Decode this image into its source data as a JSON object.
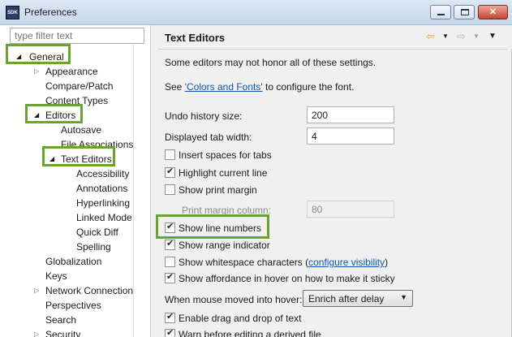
{
  "window": {
    "title": "Preferences",
    "icon_text": "SDK"
  },
  "filter": {
    "placeholder": "type filter text"
  },
  "tree": [
    {
      "label": "General",
      "level": 0,
      "expanded": true
    },
    {
      "label": "Appearance",
      "level": 1,
      "expanded": false
    },
    {
      "label": "Compare/Patch",
      "level": 1
    },
    {
      "label": "Content Types",
      "level": 1
    },
    {
      "label": "Editors",
      "level": 1,
      "expanded": true
    },
    {
      "label": "Autosave",
      "level": 2
    },
    {
      "label": "File Associations",
      "level": 2
    },
    {
      "label": "Text Editors",
      "level": 2,
      "expanded": true,
      "selected": true
    },
    {
      "label": "Accessibility",
      "level": 3
    },
    {
      "label": "Annotations",
      "level": 3
    },
    {
      "label": "Hyperlinking",
      "level": 3
    },
    {
      "label": "Linked Mode",
      "level": 3
    },
    {
      "label": "Quick Diff",
      "level": 3
    },
    {
      "label": "Spelling",
      "level": 3
    },
    {
      "label": "Globalization",
      "level": 1
    },
    {
      "label": "Keys",
      "level": 1
    },
    {
      "label": "Network Connections",
      "level": 1,
      "expanded": false
    },
    {
      "label": "Perspectives",
      "level": 1
    },
    {
      "label": "Search",
      "level": 1
    },
    {
      "label": "Security",
      "level": 1,
      "expanded": false
    }
  ],
  "page": {
    "title": "Text Editors",
    "note": "Some editors may not honor all of these settings.",
    "see_prefix": "See ",
    "colors_link": "'Colors and Fonts'",
    "see_suffix": " to configure the font.",
    "undo_label": "Undo history size:",
    "undo_value": "200",
    "tab_label": "Displayed tab width:",
    "tab_value": "4",
    "checkboxes": [
      {
        "label": "Insert spaces for tabs",
        "checked": false
      },
      {
        "label": "Highlight current line",
        "checked": true
      },
      {
        "label": "Show print margin",
        "checked": false
      },
      {
        "label": "Show line numbers",
        "checked": true
      },
      {
        "label": "Show range indicator",
        "checked": true
      },
      {
        "label": "Show whitespace characters",
        "checked": false
      },
      {
        "label": "Show affordance in hover on how to make it sticky",
        "checked": true
      },
      {
        "label": "Enable drag and drop of text",
        "checked": true
      },
      {
        "label": "Warn before editing a derived file",
        "checked": true
      }
    ],
    "print_margin_label": "Print margin column:",
    "print_margin_value": "80",
    "whitespace_link_open": "(",
    "whitespace_link": "configure visibility",
    "whitespace_link_close": ")",
    "hover_label": "When mouse moved into hover:",
    "hover_value": "Enrich after delay"
  },
  "colors": {
    "highlight": "#6aa42f",
    "link": "#0b57b3"
  }
}
